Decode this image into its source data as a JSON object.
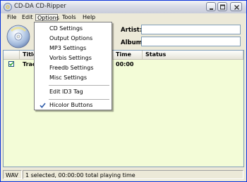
{
  "window": {
    "title": "CD-DA CD-Ripper"
  },
  "menubar": {
    "file": "File",
    "edit": "Edit",
    "options": "Options",
    "tools": "Tools",
    "help": "Help"
  },
  "info": {
    "artist_label": "Artist:",
    "album_label": "Album:",
    "artist_value": "",
    "album_value": ""
  },
  "list": {
    "columns": {
      "title": "Title",
      "time": "Time",
      "status": "Status"
    },
    "rows": [
      {
        "checked": true,
        "title": "Track",
        "time": "00:00",
        "status": ""
      }
    ]
  },
  "dropdown": {
    "items": {
      "cd_settings": "CD Settings",
      "output_options": "Output Options",
      "mp3_settings": "MP3 Settings",
      "vorbis_settings": "Vorbis Settings",
      "freedb_settings": "Freedb Settings",
      "misc_settings": "Misc Settings",
      "edit_id3": "Edit ID3 Tag",
      "hicolor": "Hicolor Buttons"
    },
    "hicolor_checked": true
  },
  "statusbar": {
    "format": "WAV",
    "info": "1 selected, 00:00:00 total playing time"
  },
  "colors": {
    "list_bg": "#f3fcd7",
    "border_accent": "#7f9db9",
    "check_blue": "#2c59a8"
  },
  "icons": [
    "app-icon",
    "cd-logo-icon",
    "minimize-icon",
    "maximize-icon",
    "close-icon",
    "checkmark-icon"
  ]
}
